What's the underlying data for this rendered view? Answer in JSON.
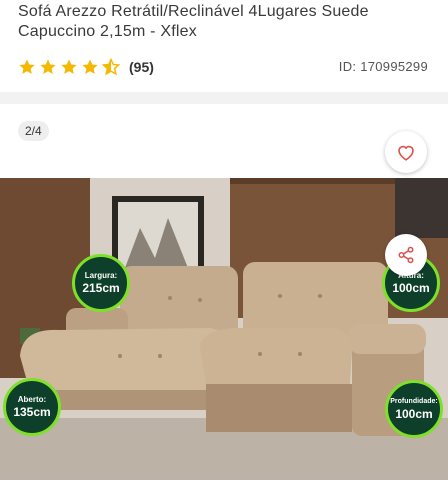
{
  "product": {
    "title": "Sofá Arezzo Retrátil/Reclinável 4Lugares Suede Capuccino 2,15m - Xflex",
    "rating_count": "(95)",
    "rating": 4.5,
    "product_id": "ID: 170995299"
  },
  "gallery": {
    "pager": "2/4",
    "badges": {
      "largura": {
        "label": "Largura:",
        "value": "215cm"
      },
      "altura": {
        "label": "Altura:",
        "value": "100cm"
      },
      "aberto": {
        "label": "Aberto:",
        "value": "135cm"
      },
      "profundidade": {
        "label": "Profundidade:",
        "value": "100cm"
      }
    }
  },
  "icons": {
    "favorite": "heart-icon",
    "share": "share-icon",
    "rating": "star-icon"
  },
  "colors": {
    "star": "#f5b800",
    "accent": "#d9534f",
    "badge_fill": "#0e3f2a",
    "badge_border": "#7ee02a"
  }
}
